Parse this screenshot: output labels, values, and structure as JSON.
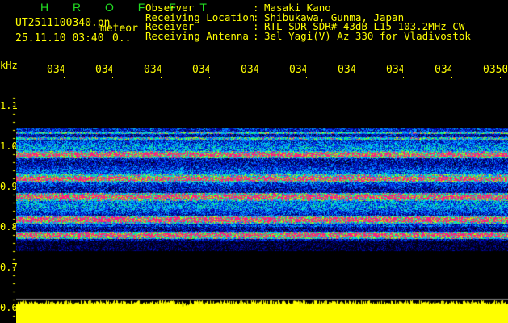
{
  "app": {
    "title": "H R O F F T"
  },
  "file": {
    "name": "UT2511100340.pn",
    "mode": "meteor",
    "datetime": "25.11.10 03:40",
    "count": "0.."
  },
  "info": [
    {
      "label": "Observer",
      "value": "Masaki Kano"
    },
    {
      "label": "Receiving Location",
      "value": "Shibukawa, Gunma, Japan"
    },
    {
      "label": "Receiver",
      "value": "RTL-SDR SDR# 43dB L15 103.2MHz CW"
    },
    {
      "label": "Receiving Antenna",
      "value": "3el Yagi(V) Az 330 for Vladivostok"
    }
  ],
  "chart_data": {
    "type": "heatmap",
    "ylabel": "kHz",
    "y_ticks": [
      "1.1",
      "1.0",
      "0.9",
      "0.8",
      "0.7",
      "0.6"
    ],
    "x_ticks": [
      "0341",
      "0342",
      "0343",
      "0344",
      "0345",
      "0346",
      "0347",
      "0348",
      "0349",
      "0350"
    ],
    "signal_band_khz": [
      0.76,
      1.04
    ],
    "strong_lines_khz": [
      0.98,
      0.92,
      0.875,
      0.82,
      0.78
    ],
    "colors": {
      "low": "#000080",
      "mid": "#00e0e0",
      "high": "#ff1a80",
      "bars": "#ffff00"
    }
  }
}
